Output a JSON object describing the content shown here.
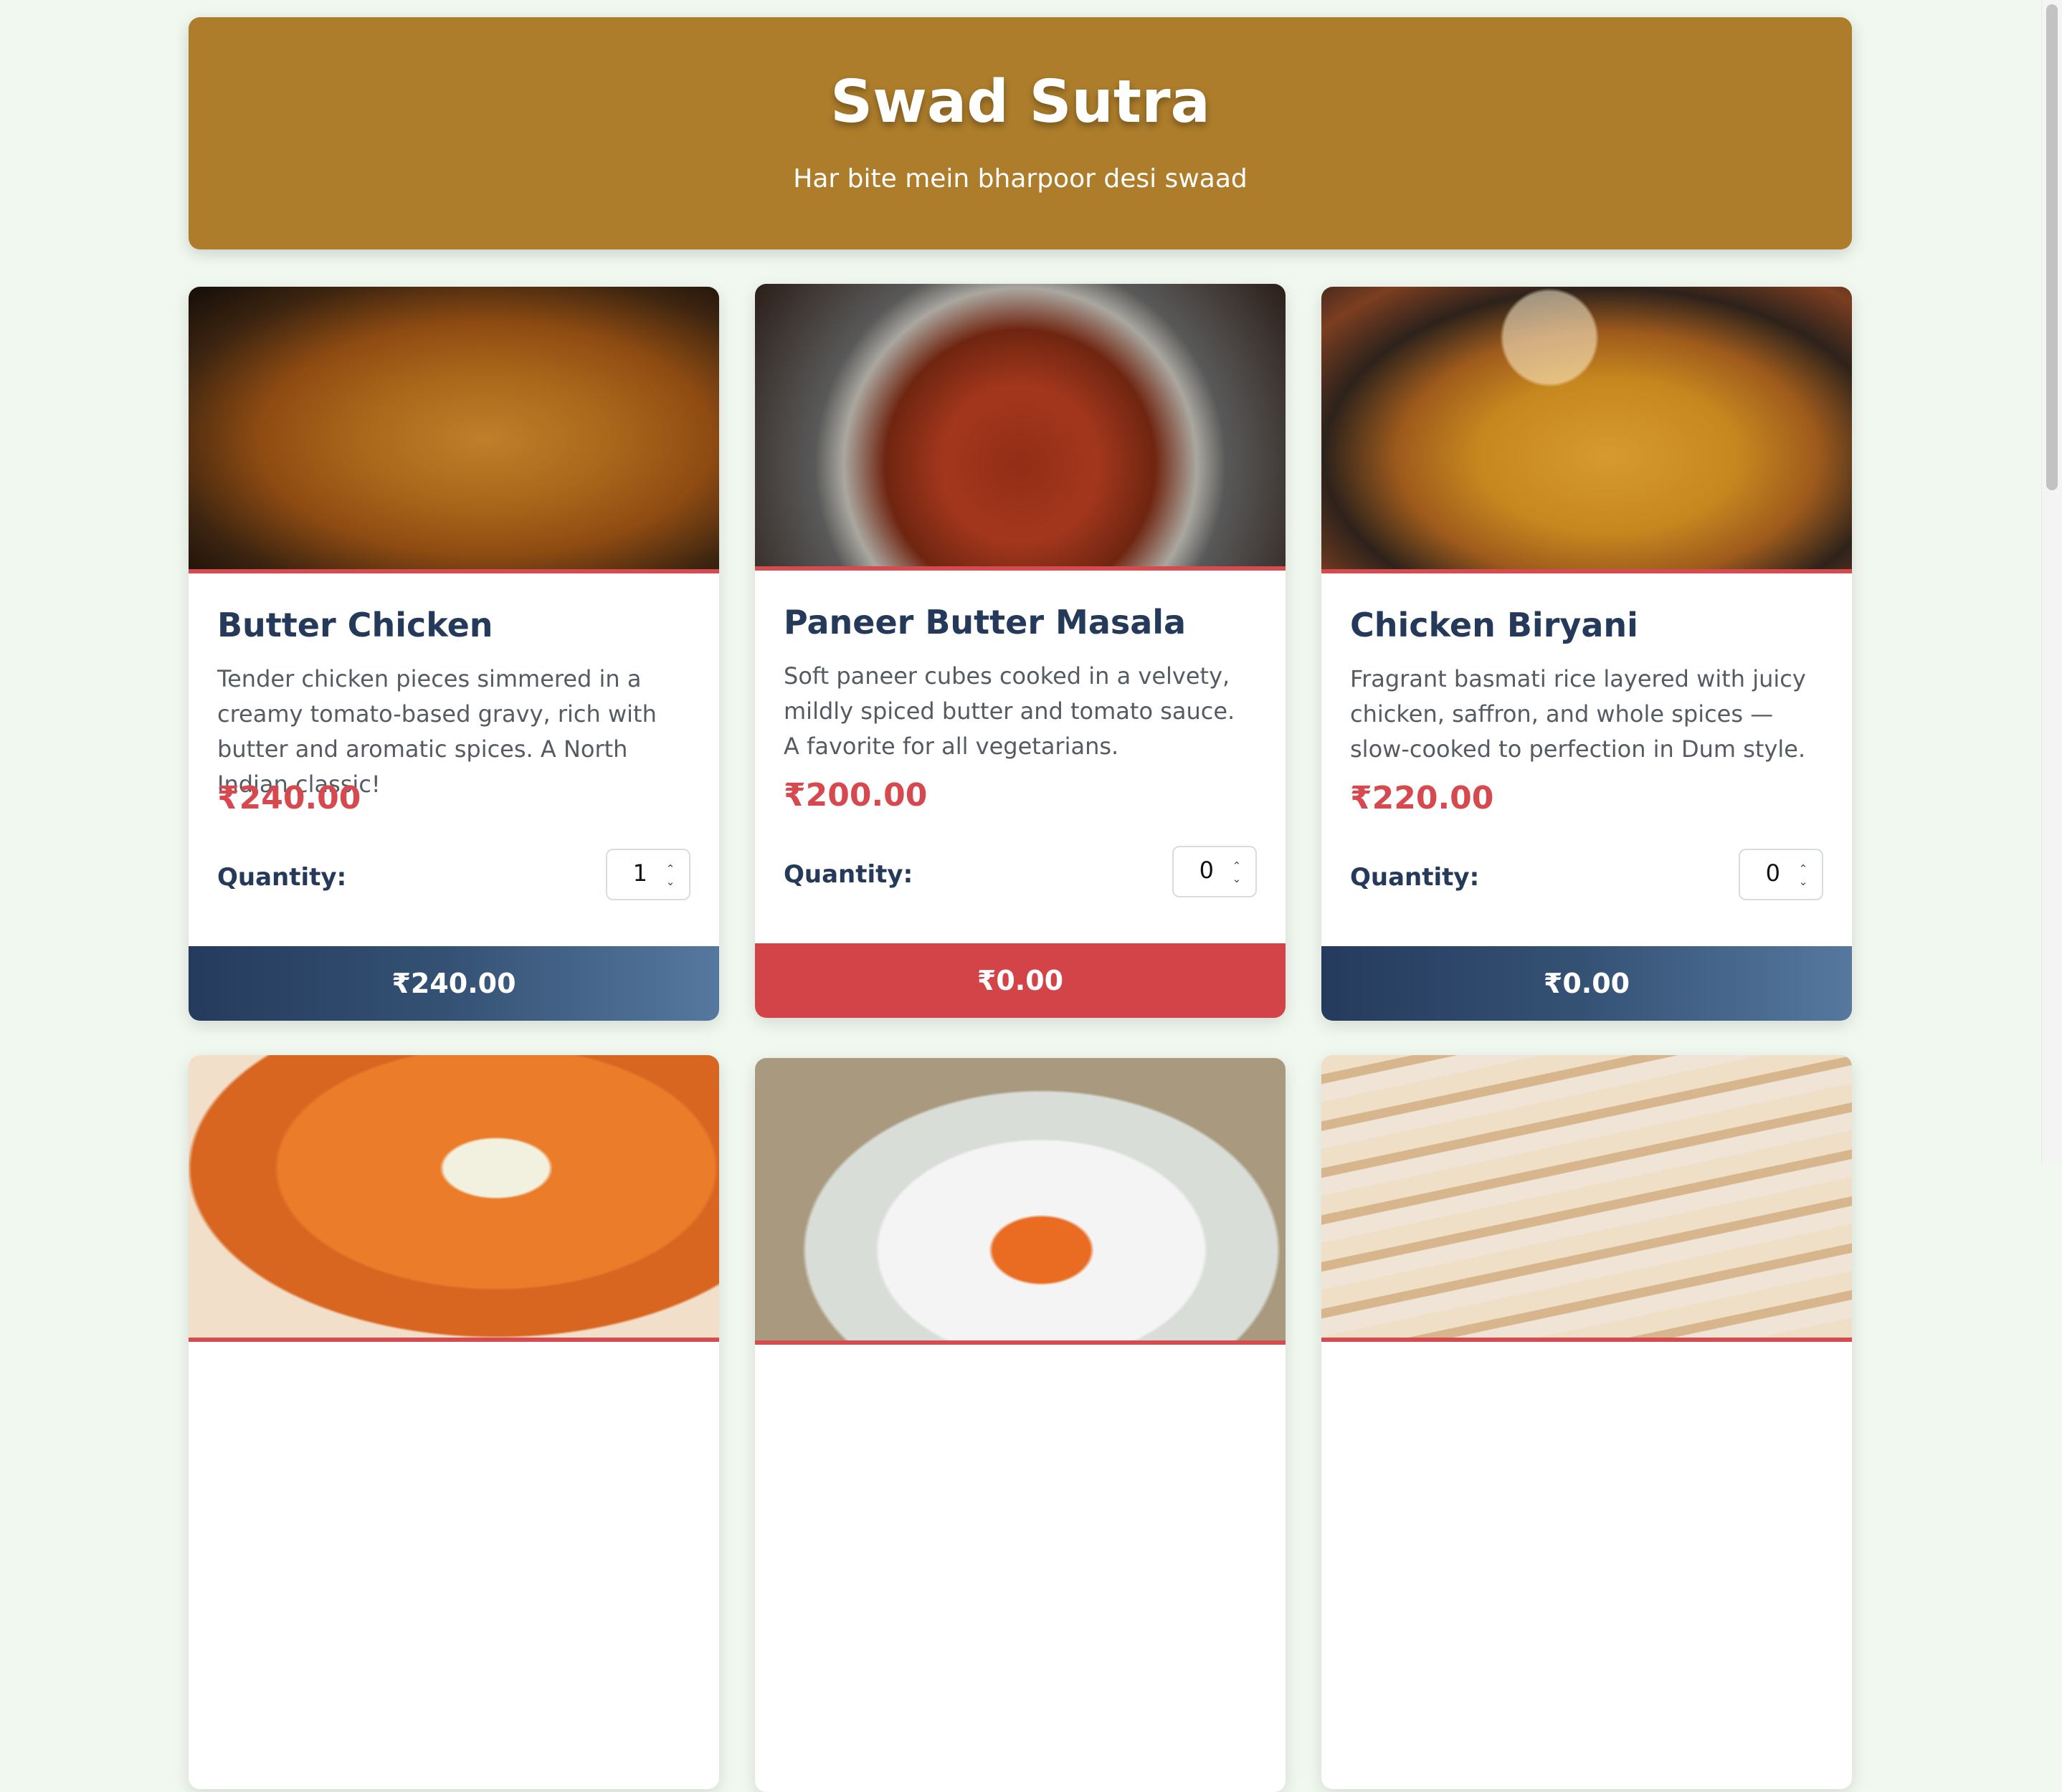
{
  "header": {
    "title": "Swad Sutra",
    "subtitle": "Har bite mein bharpoor desi swaad"
  },
  "colors": {
    "background": "#f1f8f0",
    "header": "#ad7d2b",
    "heading_text": "#253a5a",
    "price": "#d64a4f",
    "active_total": "#d34449",
    "total_gradient_start": "#253b5d",
    "total_gradient_end": "#56789f"
  },
  "quantity_label": "Quantity:",
  "cards": [
    {
      "name": "Butter Chicken",
      "description": "Tender chicken pieces simmered in a creamy tomato-based gravy, rich with butter and aromatic spices. A North Indian classic!",
      "price": "₹240.00",
      "quantity": "1",
      "total": "₹240.00",
      "image_icon": "butter-chicken-image-icon"
    },
    {
      "name": "Paneer Butter Masala",
      "description": "Soft paneer cubes cooked in a velvety, mildly spiced butter and tomato sauce. A favorite for all vegetarians.",
      "price": "₹200.00",
      "quantity": "0",
      "total": "₹0.00",
      "image_icon": "paneer-butter-masala-image-icon"
    },
    {
      "name": "Chicken Biryani",
      "description": "Fragrant basmati rice layered with juicy chicken, saffron, and whole spices — slow-cooked to perfection in Dum style.",
      "price": "₹220.00",
      "quantity": "0",
      "total": "₹0.00",
      "image_icon": "chicken-biryani-image-icon"
    }
  ],
  "partial_cards": [
    {
      "image_icon": "orange-curry-image-icon"
    },
    {
      "image_icon": "rice-plate-image-icon"
    },
    {
      "image_icon": "naan-bread-image-icon"
    }
  ]
}
